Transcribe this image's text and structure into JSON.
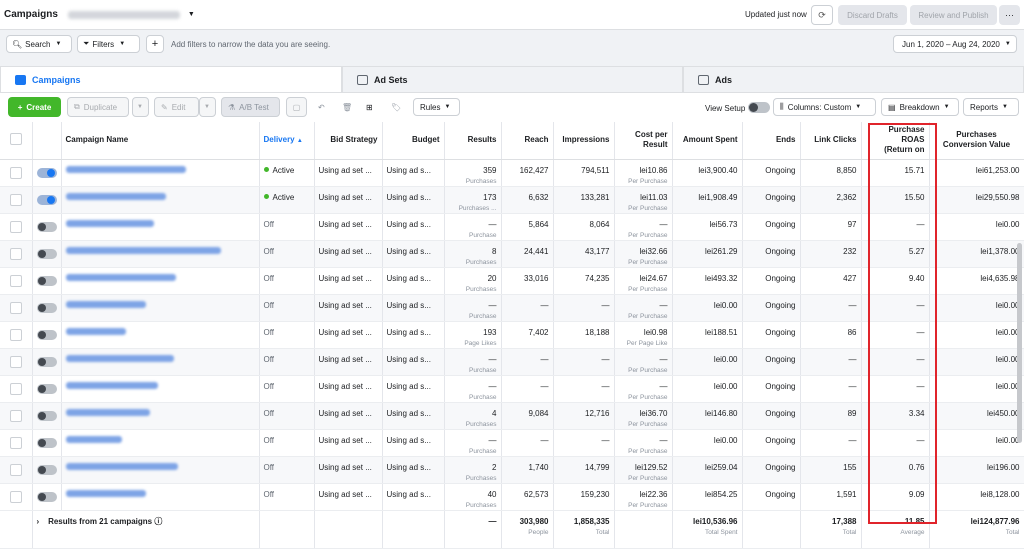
{
  "topbar": {
    "title": "Campaigns",
    "updated": "Updated just now",
    "discard": "Discard Drafts",
    "review": "Review and Publish",
    "more": "···"
  },
  "filterbar": {
    "search": "Search",
    "filters": "Filters",
    "hint": "Add filters to narrow the data you are seeing.",
    "date_range": "Jun 1, 2020 – Aug 24, 2020"
  },
  "tabs": {
    "campaigns": "Campaigns",
    "adsets": "Ad Sets",
    "ads": "Ads"
  },
  "toolbar": {
    "create": "Create",
    "duplicate": "Duplicate",
    "edit": "Edit",
    "ab_test": "A/B Test",
    "rules": "Rules",
    "view_setup": "View Setup",
    "columns": "Columns: Custom",
    "breakdown": "Breakdown",
    "reports": "Reports"
  },
  "columns": {
    "name": "Campaign Name",
    "delivery": "Delivery",
    "bid": "Bid Strategy",
    "budget": "Budget",
    "results": "Results",
    "reach": "Reach",
    "impressions": "Impressions",
    "cost_a": "Cost per",
    "cost_b": "Result",
    "spent": "Amount Spent",
    "ends": "Ends",
    "clicks": "Link Clicks",
    "roas_a": "Purchase",
    "roas_b": "ROAS",
    "roas_c": "(Return on",
    "pcv_a": "Purchases",
    "pcv_b": "Conversion Value"
  },
  "rows": [
    {
      "on": true,
      "delivery": "Active",
      "active": true,
      "bid": "Using ad set ...",
      "budget": "Using ad s...",
      "results": "359",
      "results_sub": "Purchases",
      "reach": "162,427",
      "impressions": "794,511",
      "cost": "lei10.86",
      "cost_sub": "Per Purchase",
      "spent": "lei3,900.40",
      "ends": "Ongoing",
      "clicks": "8,850",
      "roas": "15.71",
      "pcv": "lei61,253.00",
      "name_w": 120
    },
    {
      "on": true,
      "delivery": "Active",
      "active": true,
      "bid": "Using ad set ...",
      "budget": "Using ad s...",
      "results": "173",
      "results_sub": "Purchases ...",
      "reach": "6,632",
      "impressions": "133,281",
      "cost": "lei11.03",
      "cost_sub": "Per Purchase",
      "spent": "lei1,908.49",
      "ends": "Ongoing",
      "clicks": "2,362",
      "roas": "15.50",
      "pcv": "lei29,550.98",
      "name_w": 100
    },
    {
      "on": false,
      "delivery": "Off",
      "active": false,
      "bid": "Using ad set ...",
      "budget": "Using ad s...",
      "results": "—",
      "results_sub": "Purchase",
      "reach": "5,864",
      "impressions": "8,064",
      "cost": "—",
      "cost_sub": "Per Purchase",
      "spent": "lei56.73",
      "ends": "Ongoing",
      "clicks": "97",
      "roas": "—",
      "pcv": "lei0.00",
      "name_w": 88
    },
    {
      "on": false,
      "delivery": "Off",
      "active": false,
      "bid": "Using ad set ...",
      "budget": "Using ad s...",
      "results": "8",
      "results_sub": "Purchases",
      "reach": "24,441",
      "impressions": "43,177",
      "cost": "lei32.66",
      "cost_sub": "Per Purchase",
      "spent": "lei261.29",
      "ends": "Ongoing",
      "clicks": "232",
      "roas": "5.27",
      "pcv": "lei1,378.00",
      "name_w": 155
    },
    {
      "on": false,
      "delivery": "Off",
      "active": false,
      "bid": "Using ad set ...",
      "budget": "Using ad s...",
      "results": "20",
      "results_sub": "Purchases",
      "reach": "33,016",
      "impressions": "74,235",
      "cost": "lei24.67",
      "cost_sub": "Per Purchase",
      "spent": "lei493.32",
      "ends": "Ongoing",
      "clicks": "427",
      "roas": "9.40",
      "pcv": "lei4,635.98",
      "name_w": 110
    },
    {
      "on": false,
      "delivery": "Off",
      "active": false,
      "bid": "Using ad set ...",
      "budget": "Using ad s...",
      "results": "—",
      "results_sub": "Purchase",
      "reach": "—",
      "impressions": "—",
      "cost": "—",
      "cost_sub": "Per Purchase",
      "spent": "lei0.00",
      "ends": "Ongoing",
      "clicks": "—",
      "roas": "—",
      "pcv": "lei0.00",
      "name_w": 80
    },
    {
      "on": false,
      "delivery": "Off",
      "active": false,
      "bid": "Using ad set ...",
      "budget": "Using ad s...",
      "results": "193",
      "results_sub": "Page Likes",
      "reach": "7,402",
      "impressions": "18,188",
      "cost": "lei0.98",
      "cost_sub": "Per Page Like",
      "spent": "lei188.51",
      "ends": "Ongoing",
      "clicks": "86",
      "roas": "—",
      "pcv": "lei0.00",
      "name_w": 60
    },
    {
      "on": false,
      "delivery": "Off",
      "active": false,
      "bid": "Using ad set ...",
      "budget": "Using ad s...",
      "results": "—",
      "results_sub": "Purchase",
      "reach": "—",
      "impressions": "—",
      "cost": "—",
      "cost_sub": "Per Purchase",
      "spent": "lei0.00",
      "ends": "Ongoing",
      "clicks": "—",
      "roas": "—",
      "pcv": "lei0.00",
      "name_w": 108
    },
    {
      "on": false,
      "delivery": "Off",
      "active": false,
      "bid": "Using ad set ...",
      "budget": "Using ad s...",
      "results": "—",
      "results_sub": "Purchase",
      "reach": "—",
      "impressions": "—",
      "cost": "—",
      "cost_sub": "Per Purchase",
      "spent": "lei0.00",
      "ends": "Ongoing",
      "clicks": "—",
      "roas": "—",
      "pcv": "lei0.00",
      "name_w": 92
    },
    {
      "on": false,
      "delivery": "Off",
      "active": false,
      "bid": "Using ad set ...",
      "budget": "Using ad s...",
      "results": "4",
      "results_sub": "Purchases",
      "reach": "9,084",
      "impressions": "12,716",
      "cost": "lei36.70",
      "cost_sub": "Per Purchase",
      "spent": "lei146.80",
      "ends": "Ongoing",
      "clicks": "89",
      "roas": "3.34",
      "pcv": "lei450.00",
      "name_w": 84
    },
    {
      "on": false,
      "delivery": "Off",
      "active": false,
      "bid": "Using ad set ...",
      "budget": "Using ad s...",
      "results": "—",
      "results_sub": "Purchase",
      "reach": "—",
      "impressions": "—",
      "cost": "—",
      "cost_sub": "Per Purchase",
      "spent": "lei0.00",
      "ends": "Ongoing",
      "clicks": "—",
      "roas": "—",
      "pcv": "lei0.00",
      "name_w": 56
    },
    {
      "on": false,
      "delivery": "Off",
      "active": false,
      "bid": "Using ad set ...",
      "budget": "Using ad s...",
      "results": "2",
      "results_sub": "Purchases",
      "reach": "1,740",
      "impressions": "14,799",
      "cost": "lei129.52",
      "cost_sub": "Per Purchase",
      "spent": "lei259.04",
      "ends": "Ongoing",
      "clicks": "155",
      "roas": "0.76",
      "pcv": "lei196.00",
      "name_w": 112
    },
    {
      "on": false,
      "delivery": "Off",
      "active": false,
      "bid": "Using ad set ...",
      "budget": "Using ad s...",
      "results": "40",
      "results_sub": "Purchases",
      "reach": "62,573",
      "impressions": "159,230",
      "cost": "lei22.36",
      "cost_sub": "Per Purchase",
      "spent": "lei854.25",
      "ends": "Ongoing",
      "clicks": "1,591",
      "roas": "9.09",
      "pcv": "lei8,128.00",
      "name_w": 80
    }
  ],
  "totals": {
    "label": "Results from 21 campaigns",
    "results": "—",
    "reach": "303,980",
    "reach_sub": "People",
    "impressions": "1,858,335",
    "impressions_sub": "Total",
    "spent": "lei10,536.96",
    "spent_sub": "Total Spent",
    "clicks": "17,388",
    "clicks_sub": "Total",
    "roas": "11.85",
    "roas_sub": "Average",
    "pcv": "lei124,877.96",
    "pcv_sub": "Total"
  },
  "colors": {
    "accent": "#1877f2",
    "create": "#42b72a",
    "highlight": "#e0242b"
  }
}
